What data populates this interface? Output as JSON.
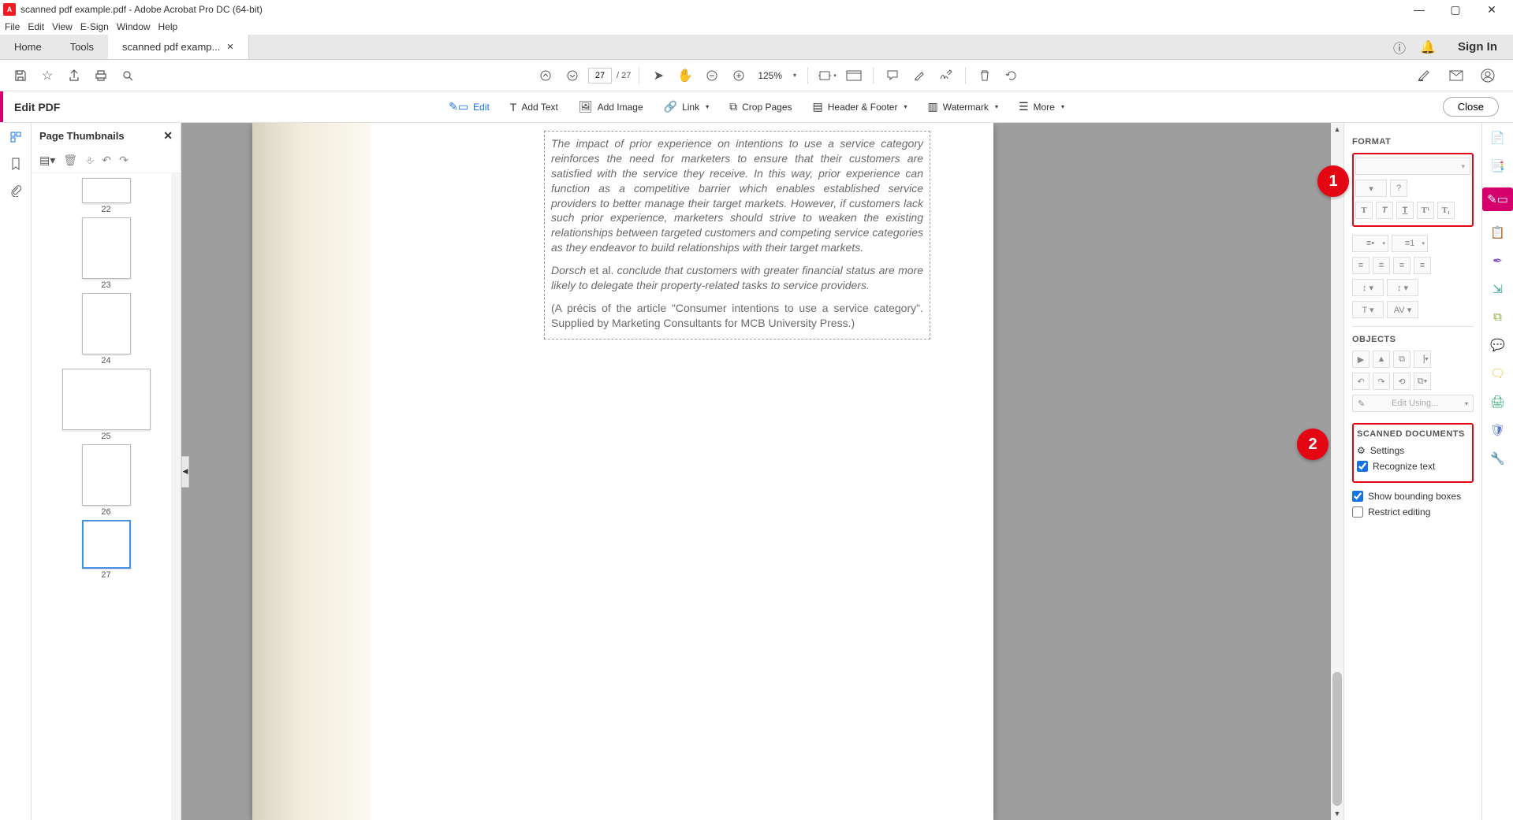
{
  "window": {
    "title": "scanned pdf example.pdf - Adobe Acrobat Pro DC (64-bit)"
  },
  "menubar": [
    "File",
    "Edit",
    "View",
    "E-Sign",
    "Window",
    "Help"
  ],
  "tabs": {
    "home": "Home",
    "tools": "Tools",
    "doc": "scanned pdf examp...",
    "signin": "Sign In"
  },
  "quickbar": {
    "page_current": "27",
    "page_total": "/ 27",
    "zoom": "125%"
  },
  "editbar": {
    "title": "Edit PDF",
    "tools": {
      "edit": "Edit",
      "add_text": "Add Text",
      "add_image": "Add Image",
      "link": "Link",
      "crop": "Crop Pages",
      "header": "Header & Footer",
      "watermark": "Watermark",
      "more": "More"
    },
    "close": "Close"
  },
  "thumbnails": {
    "title": "Page Thumbnails",
    "pages": [
      "22",
      "23",
      "24",
      "25",
      "26",
      "27"
    ]
  },
  "document": {
    "p1": "The impact of prior experience on intentions to use a service category reinforces the need for marketers to ensure that their customers are satisfied with the service they receive. In this way, prior experience can function as a competitive barrier which enables established service providers to better manage their target markets. However, if customers lack such prior experience, marketers should strive to weaken the existing relationships between targeted customers and competing service categories as they endeavor to build relationships with their target markets.",
    "p2a": "Dorsch ",
    "p2b": "et al.",
    "p2c": " conclude that customers with greater financial status are more likely to delegate their property-related tasks to service providers.",
    "p3": "(A précis of the article \"Consumer intentions to use a service category\". Supplied by Marketing Consultants for MCB University Press.)"
  },
  "format": {
    "header": "FORMAT",
    "objects_header": "OBJECTS",
    "edit_using": "Edit Using...",
    "scanned_header": "SCANNED DOCUMENTS",
    "settings": "Settings",
    "recognize": "Recognize text",
    "show_bbox": "Show bounding boxes",
    "restrict": "Restrict editing"
  },
  "badges": {
    "b1": "1",
    "b2": "2"
  }
}
